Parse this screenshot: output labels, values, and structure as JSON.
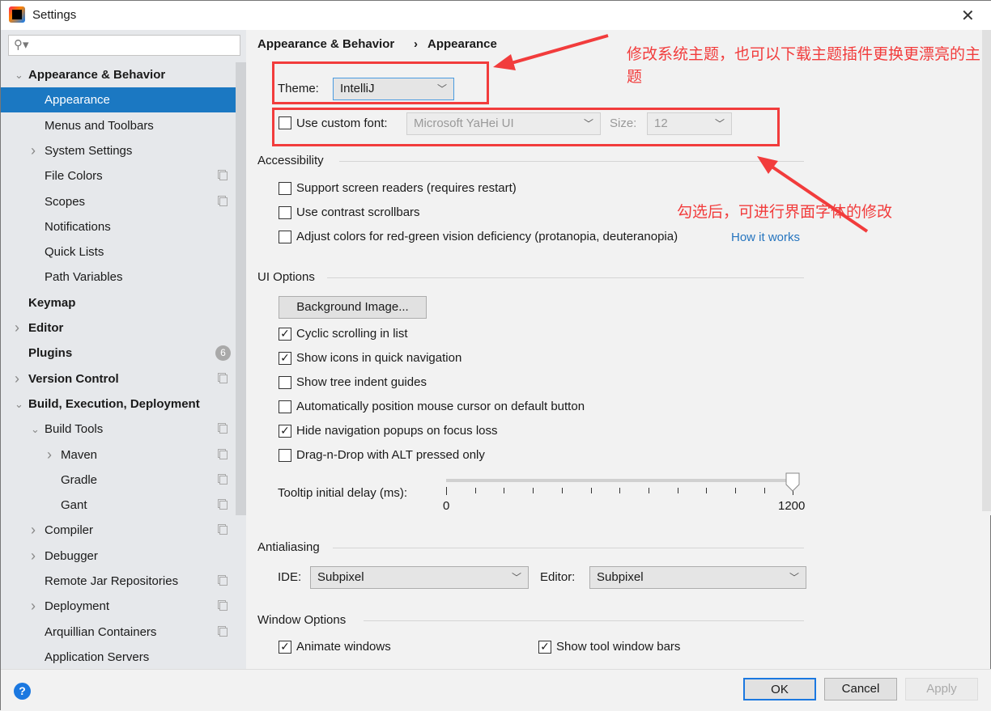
{
  "window": {
    "title": "Settings",
    "close": "✕"
  },
  "search": {
    "placeholder": "",
    "icon": "search-icon"
  },
  "sidebar": {
    "items": [
      {
        "label": "Appearance & Behavior",
        "level": 0,
        "bold": true,
        "arrow": "expanded"
      },
      {
        "label": "Appearance",
        "level": 1,
        "selected": true
      },
      {
        "label": "Menus and Toolbars",
        "level": 1
      },
      {
        "label": "System Settings",
        "level": 1,
        "arrow": "collapsed"
      },
      {
        "label": "File Colors",
        "level": 1,
        "copy": true
      },
      {
        "label": "Scopes",
        "level": 1,
        "copy": true
      },
      {
        "label": "Notifications",
        "level": 1
      },
      {
        "label": "Quick Lists",
        "level": 1
      },
      {
        "label": "Path Variables",
        "level": 1
      },
      {
        "label": "Keymap",
        "level": 0,
        "bold": true
      },
      {
        "label": "Editor",
        "level": 0,
        "bold": true,
        "arrow": "collapsed"
      },
      {
        "label": "Plugins",
        "level": 0,
        "bold": true,
        "badge": "6"
      },
      {
        "label": "Version Control",
        "level": 0,
        "bold": true,
        "arrow": "collapsed",
        "copy": true
      },
      {
        "label": "Build, Execution, Deployment",
        "level": 0,
        "bold": true,
        "arrow": "expanded"
      },
      {
        "label": "Build Tools",
        "level": 1,
        "arrow": "expanded",
        "copy": true
      },
      {
        "label": "Maven",
        "level": 2,
        "arrow": "collapsed",
        "copy": true
      },
      {
        "label": "Gradle",
        "level": 2,
        "copy": true
      },
      {
        "label": "Gant",
        "level": 2,
        "copy": true
      },
      {
        "label": "Compiler",
        "level": 1,
        "arrow": "collapsed",
        "copy": true
      },
      {
        "label": "Debugger",
        "level": 1,
        "arrow": "collapsed"
      },
      {
        "label": "Remote Jar Repositories",
        "level": 1,
        "copy": true
      },
      {
        "label": "Deployment",
        "level": 1,
        "arrow": "collapsed",
        "copy": true
      },
      {
        "label": "Arquillian Containers",
        "level": 1,
        "copy": true
      },
      {
        "label": "Application Servers",
        "level": 1
      }
    ]
  },
  "breadcrumb": {
    "parent": "Appearance & Behavior",
    "sep": "›",
    "current": "Appearance"
  },
  "theme": {
    "label": "Theme:",
    "value": "IntelliJ"
  },
  "font": {
    "label": "Use custom font:",
    "checked": false,
    "value": "Microsoft YaHei UI",
    "size_label": "Size:",
    "size": "12"
  },
  "accessibility": {
    "title": "Accessibility",
    "items": [
      {
        "label": "Support screen readers (requires restart)",
        "checked": false
      },
      {
        "label": "Use contrast scrollbars",
        "checked": false
      },
      {
        "label": "Adjust colors for red-green vision deficiency (protanopia, deuteranopia)",
        "checked": false
      }
    ],
    "link": "How it works"
  },
  "ui_options": {
    "title": "UI Options",
    "bg_button": "Background Image...",
    "items": [
      {
        "label": "Cyclic scrolling in list",
        "checked": true
      },
      {
        "label": "Show icons in quick navigation",
        "checked": true
      },
      {
        "label": "Show tree indent guides",
        "checked": false
      },
      {
        "label": "Automatically position mouse cursor on default button",
        "checked": false
      },
      {
        "label": "Hide navigation popups on focus loss",
        "checked": true
      },
      {
        "label": "Drag-n-Drop with ALT pressed only",
        "checked": false
      }
    ],
    "tooltip_label": "Tooltip initial delay (ms):",
    "slider_min": "0",
    "slider_max": "1200",
    "slider_value": 1200
  },
  "antialiasing": {
    "title": "Antialiasing",
    "ide_label": "IDE:",
    "ide": "Subpixel",
    "editor_label": "Editor:",
    "editor": "Subpixel"
  },
  "window_options": {
    "title": "Window Options",
    "items": [
      {
        "label": "Animate windows",
        "checked": true
      },
      {
        "label": "Show tool window bars",
        "checked": true
      }
    ]
  },
  "annotations": {
    "theme_note": "修改系统主题，也可以下载主题插件更换更漂亮的主题",
    "font_note": "勾选后，可进行界面字体的修改",
    "color": "#f23c3c"
  },
  "footer": {
    "help": "?",
    "ok": "OK",
    "cancel": "Cancel",
    "apply": "Apply"
  }
}
